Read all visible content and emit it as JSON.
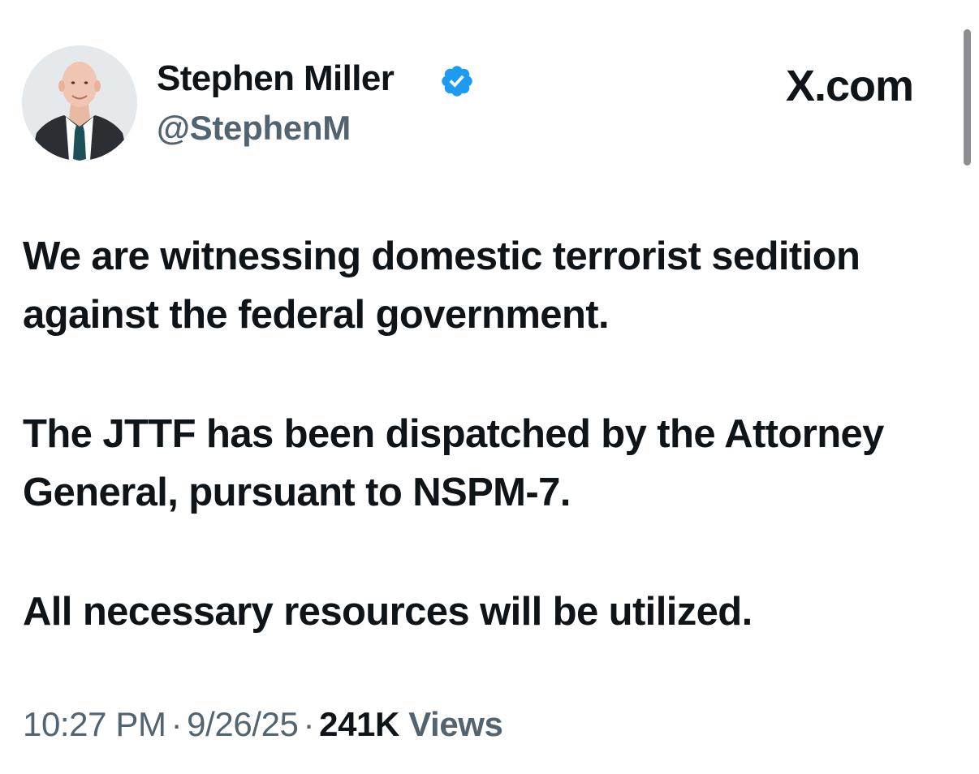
{
  "author": {
    "display_name": "Stephen Miller",
    "handle": "@StephenM",
    "verified_icon": "verified-badge-icon",
    "verified_color": "#1d9bf0"
  },
  "brand": {
    "text": "X.com"
  },
  "tweet": {
    "paragraphs": [
      "We are witnessing domestic terrorist sedition against the federal government.",
      "The JTTF has been dispatched by the Attorney General, pursuant to NSPM-7.",
      "All necessary resources will be utilized."
    ]
  },
  "meta": {
    "time": "10:27 PM",
    "separator": "·",
    "date": "9/26/25",
    "views_count": "241K",
    "views_label": "Views"
  },
  "colors": {
    "text_primary": "#0f1419",
    "text_secondary": "#536471"
  }
}
